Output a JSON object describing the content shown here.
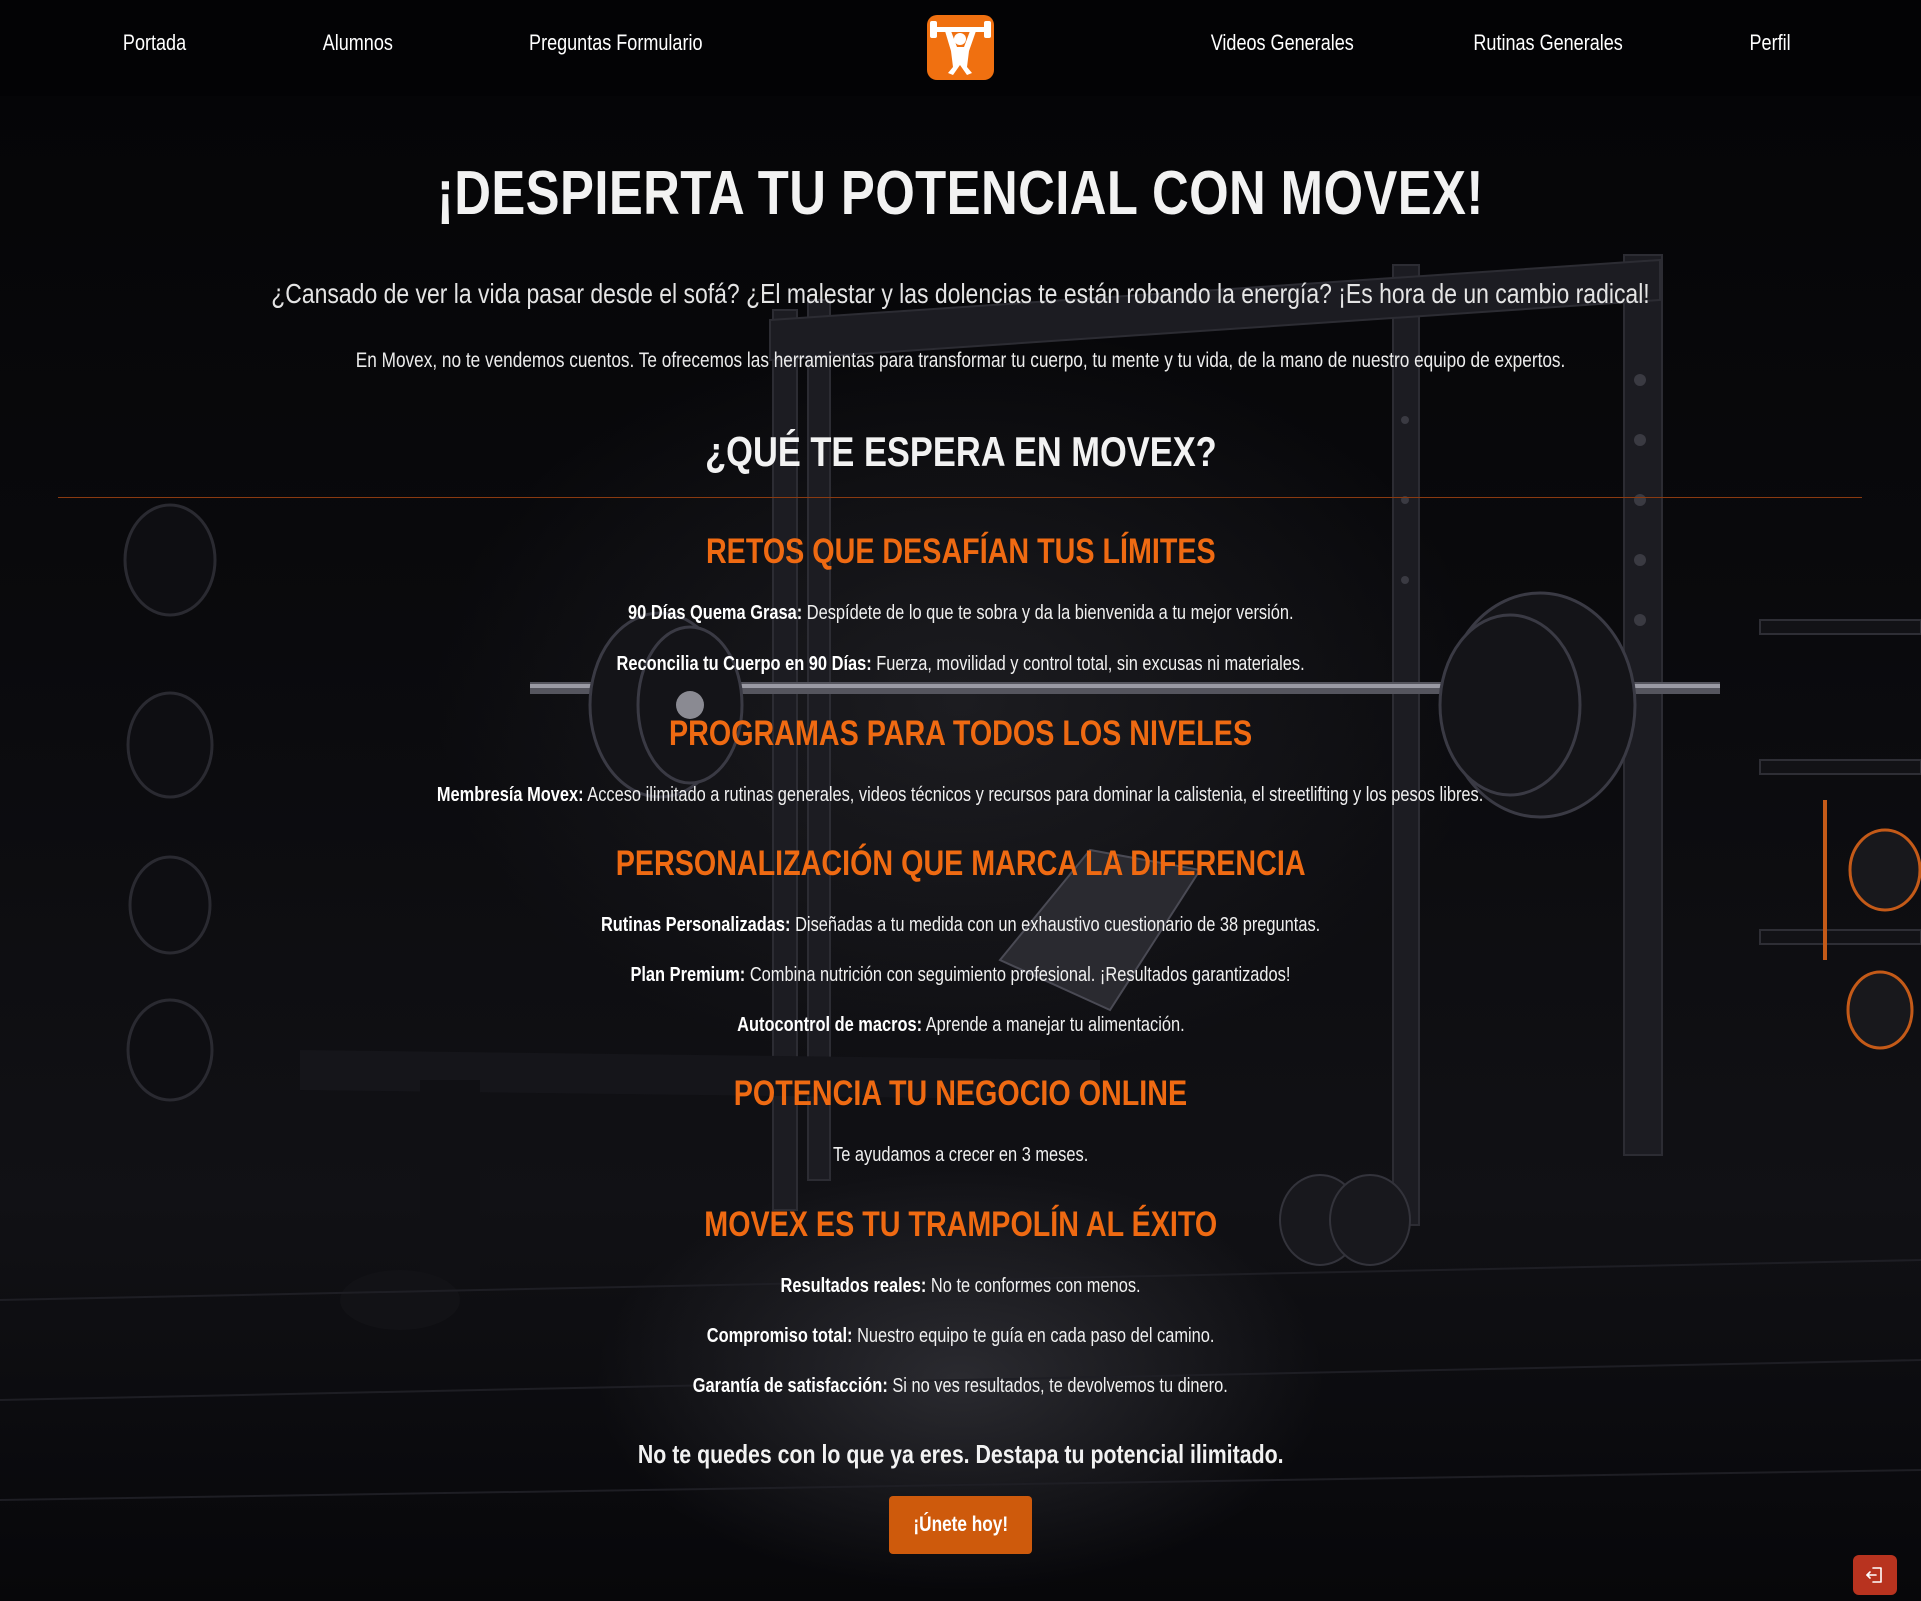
{
  "nav": {
    "items": [
      {
        "label": "Portada"
      },
      {
        "label": "Alumnos"
      },
      {
        "label": "Preguntas Formulario"
      },
      {
        "label": "Videos Generales"
      },
      {
        "label": "Rutinas Generales"
      },
      {
        "label": "Perfil"
      }
    ],
    "logo_icon": "weightlifter-icon"
  },
  "hero": {
    "title": "¡DESPIERTA TU POTENCIAL CON MOVEX!",
    "lead": "¿Cansado de ver la vida pasar desde el sofá? ¿El malestar y las dolencias te están robando la energía? ¡Es hora de un cambio radical!",
    "sub": "En Movex, no te vendemos cuentos. Te ofrecemos las herramientas para transformar tu cuerpo, tu mente y tu vida, de la mano de nuestro equipo de expertos."
  },
  "section_title": "¿QUÉ TE ESPERA EN MOVEX?",
  "sections": [
    {
      "title": "RETOS QUE DESAFÍAN TUS LÍMITES",
      "items": [
        {
          "strong": "90 Días Quema Grasa:",
          "text": " Despídete de lo que te sobra y da la bienvenida a tu mejor versión."
        },
        {
          "strong": "Reconcilia tu Cuerpo en 90 Días:",
          "text": " Fuerza, movilidad y control total, sin excusas ni materiales."
        }
      ]
    },
    {
      "title": "PROGRAMAS PARA TODOS LOS NIVELES",
      "items": [
        {
          "strong": "Membresía Movex:",
          "text": " Acceso ilimitado a rutinas generales, videos técnicos y recursos para dominar la calistenia, el streetlifting y los pesos libres."
        }
      ]
    },
    {
      "title": "PERSONALIZACIÓN QUE MARCA LA DIFERENCIA",
      "items": [
        {
          "strong": "Rutinas Personalizadas:",
          "text": " Diseñadas a tu medida con un exhaustivo cuestionario de 38 preguntas."
        },
        {
          "strong": "Plan Premium:",
          "text": " Combina nutrición con seguimiento profesional. ¡Resultados garantizados!"
        },
        {
          "strong": "Autocontrol de macros:",
          "text": " Aprende a manejar tu alimentación."
        }
      ]
    },
    {
      "title": "POTENCIA TU NEGOCIO ONLINE",
      "items": [
        {
          "strong": "",
          "text": "Te ayudamos a crecer en 3 meses."
        }
      ]
    },
    {
      "title": "MOVEX ES TU TRAMPOLÍN AL ÉXITO",
      "items": [
        {
          "strong": "Resultados reales:",
          "text": " No te conformes con menos."
        },
        {
          "strong": "Compromiso total:",
          "text": " Nuestro equipo te guía en cada paso del camino."
        },
        {
          "strong": "Garantía de satisfacción:",
          "text": " Si no ves resultados, te devolvemos tu dinero."
        }
      ]
    }
  ],
  "closing": "No te quedes con lo que ya eres. Destapa tu potencial ilimitado.",
  "cta_label": "¡Únete hoy!",
  "logout_icon": "logout-icon",
  "colors": {
    "accent": "#f07010",
    "heading_orange": "#ef6a12",
    "button": "#ce5a0c",
    "logout": "#b8331f",
    "background": "#050507"
  }
}
